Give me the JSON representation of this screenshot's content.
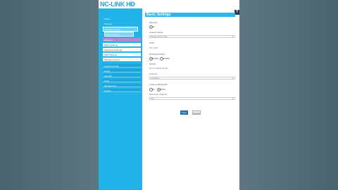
{
  "header": {
    "logo": "NC-LINK",
    "logo_suffix": "HD",
    "logo_sub": "tech",
    "help": "?"
  },
  "sidebar": {
    "items": [
      {
        "label": "Status"
      },
      {
        "label": "Network"
      },
      {
        "label": "Wireless Setting"
      },
      {
        "label": "Basic Setting"
      },
      {
        "label": "Wireless"
      },
      {
        "label": "Basic Settings"
      },
      {
        "label": "Advanced Settings"
      },
      {
        "label": "WPS Settings"
      },
      {
        "label": "Wireless Control"
      },
      {
        "label": "Access Control"
      },
      {
        "label": "Route"
      },
      {
        "label": "Firewall"
      },
      {
        "label": "Tools"
      },
      {
        "label": "Management"
      },
      {
        "label": "System"
      }
    ]
  },
  "main": {
    "title": "Basic Settings",
    "wireless_label": "Wireless",
    "wireless_options": {
      "on": "On",
      "off": "Off"
    },
    "network_mode_label": "Network Mode",
    "network_mode_value": "11b/g/n mixed mode",
    "ssid_label": "SSID",
    "ssid_value": "NC-LINK",
    "broadcast_label": "Broadcast(SSID)",
    "broadcast_options": {
      "enable": "Enable",
      "disable": "Disable"
    },
    "bssid_label": "BSSID",
    "bssid_value": "00:1C:A8:3D:0F:2E",
    "channel_label": "Channel",
    "channel_value": "AutoSelect",
    "bandwidth_label": "Channel Bandwidth",
    "bandwidth_options": {
      "a": "20",
      "b": "20/40"
    },
    "extension_label": "Extension Channel",
    "extension_value": "Auto",
    "save_label": "Save",
    "cancel_label": "Cancel"
  }
}
